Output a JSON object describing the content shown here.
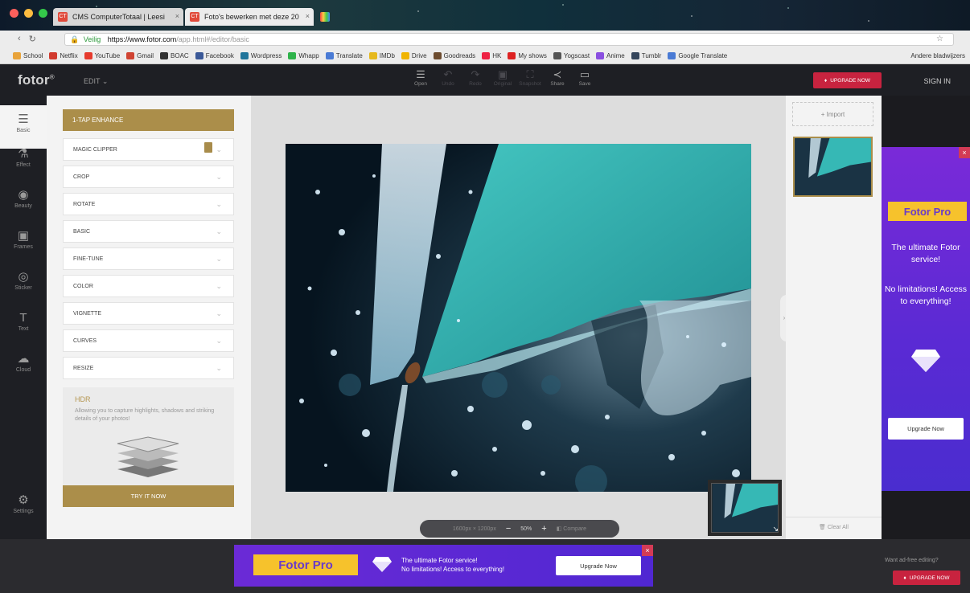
{
  "browser": {
    "tabs": [
      {
        "title": "CMS ComputerTotaal | Leesi"
      },
      {
        "title": "Foto's bewerken met deze 20"
      },
      {
        "title": ""
      }
    ],
    "url": {
      "secure": "Veilig",
      "host": "https://www.fotor.com",
      "path": "/app.html#/editor/basic"
    },
    "bookmarks": [
      "School",
      "Netflix",
      "YouTube",
      "Gmail",
      "BOAC",
      "Facebook",
      "Wordpress",
      "Whapp",
      "Translate",
      "IMDb",
      "Drive",
      "Goodreads",
      "HK",
      "My shows",
      "Yogscast",
      "Anime",
      "Tumblr",
      "Google Translate"
    ],
    "other_bookmarks": "Andere bladwijzers"
  },
  "header": {
    "logo": "fotor",
    "logo_mark": "®",
    "edit_menu": "EDIT",
    "toolbar": [
      {
        "label": "Open",
        "icon": "menu-icon",
        "glyph": "☰",
        "enabled": true
      },
      {
        "label": "Undo",
        "icon": "undo-icon",
        "glyph": "↶",
        "enabled": false
      },
      {
        "label": "Redo",
        "icon": "redo-icon",
        "glyph": "↷",
        "enabled": false
      },
      {
        "label": "Original",
        "icon": "original-icon",
        "glyph": "▣",
        "enabled": false
      },
      {
        "label": "Snapshot",
        "icon": "snapshot-icon",
        "glyph": "⛶",
        "enabled": false
      },
      {
        "label": "Share",
        "icon": "share-icon",
        "glyph": "≺",
        "enabled": true
      },
      {
        "label": "Save",
        "icon": "save-icon",
        "glyph": "▭",
        "enabled": true
      }
    ],
    "upgrade": "UPGRADE NOW",
    "signin": "SIGN IN"
  },
  "rail": [
    {
      "label": "Basic",
      "icon": "sliders-icon",
      "glyph": "☰"
    },
    {
      "label": "Effect",
      "icon": "flask-icon",
      "glyph": "⚗"
    },
    {
      "label": "Beauty",
      "icon": "eye-icon",
      "glyph": "◉"
    },
    {
      "label": "Frames",
      "icon": "frame-icon",
      "glyph": "▣"
    },
    {
      "label": "Sticker",
      "icon": "sticker-icon",
      "glyph": "◎"
    },
    {
      "label": "Text",
      "icon": "text-icon",
      "glyph": "T"
    },
    {
      "label": "Cloud",
      "icon": "cloud-icon",
      "glyph": "☁"
    }
  ],
  "rail_settings": {
    "label": "Settings",
    "icon": "gear-icon",
    "glyph": "⚙"
  },
  "panel": {
    "tap_enhance": "1-TAP ENHANCE",
    "options": [
      "MAGIC CLIPPER",
      "CROP",
      "ROTATE",
      "BASIC",
      "FINE-TUNE",
      "COLOR",
      "VIGNETTE",
      "CURVES",
      "RESIZE"
    ],
    "hdr": {
      "title": "HDR",
      "description": "Allowing you to capture highlights, shadows and striking details of your photos!",
      "button": "TRY IT NOW"
    }
  },
  "canvas": {
    "dimensions": "1600px × 1200px",
    "zoom": "50%",
    "compare": "Compare",
    "zoom_out": "−",
    "zoom_in": "+"
  },
  "thumbs": {
    "import": "+ Import",
    "clear_all": "Clear All"
  },
  "side_ad": {
    "badge": "Fotor Pro",
    "line1": "The ultimate Fotor service!",
    "line2": "No limitations! Access to everything!",
    "button": "Upgrade Now",
    "close": "×"
  },
  "bottom_ad": {
    "badge": "Fotor Pro",
    "line1": "The ultimate Fotor service!",
    "line2": "No limitations! Access to everything!",
    "button": "Upgrade Now",
    "close": "×"
  },
  "ad_free": {
    "text": "Want ad-free editing?",
    "button": "UPGRADE NOW"
  },
  "colors": {
    "gold": "#ab8e4a",
    "upgrade_red": "#c8233f",
    "ad_purple": "#5b2ad4",
    "badge_yellow": "#f6c22c"
  }
}
